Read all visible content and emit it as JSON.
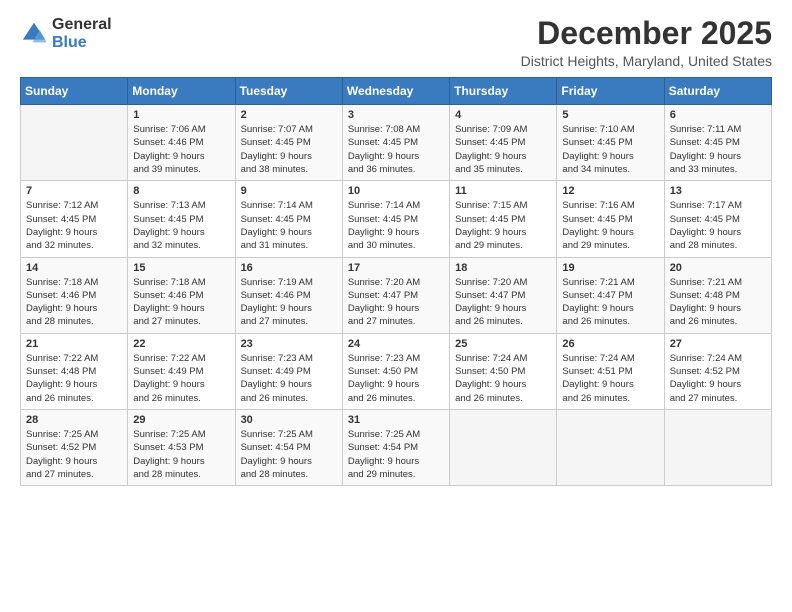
{
  "logo": {
    "general": "General",
    "blue": "Blue"
  },
  "header": {
    "month": "December 2025",
    "location": "District Heights, Maryland, United States"
  },
  "days_of_week": [
    "Sunday",
    "Monday",
    "Tuesday",
    "Wednesday",
    "Thursday",
    "Friday",
    "Saturday"
  ],
  "weeks": [
    [
      {
        "day": "",
        "info": ""
      },
      {
        "day": "1",
        "info": "Sunrise: 7:06 AM\nSunset: 4:46 PM\nDaylight: 9 hours\nand 39 minutes."
      },
      {
        "day": "2",
        "info": "Sunrise: 7:07 AM\nSunset: 4:45 PM\nDaylight: 9 hours\nand 38 minutes."
      },
      {
        "day": "3",
        "info": "Sunrise: 7:08 AM\nSunset: 4:45 PM\nDaylight: 9 hours\nand 36 minutes."
      },
      {
        "day": "4",
        "info": "Sunrise: 7:09 AM\nSunset: 4:45 PM\nDaylight: 9 hours\nand 35 minutes."
      },
      {
        "day": "5",
        "info": "Sunrise: 7:10 AM\nSunset: 4:45 PM\nDaylight: 9 hours\nand 34 minutes."
      },
      {
        "day": "6",
        "info": "Sunrise: 7:11 AM\nSunset: 4:45 PM\nDaylight: 9 hours\nand 33 minutes."
      }
    ],
    [
      {
        "day": "7",
        "info": "Sunrise: 7:12 AM\nSunset: 4:45 PM\nDaylight: 9 hours\nand 32 minutes."
      },
      {
        "day": "8",
        "info": "Sunrise: 7:13 AM\nSunset: 4:45 PM\nDaylight: 9 hours\nand 32 minutes."
      },
      {
        "day": "9",
        "info": "Sunrise: 7:14 AM\nSunset: 4:45 PM\nDaylight: 9 hours\nand 31 minutes."
      },
      {
        "day": "10",
        "info": "Sunrise: 7:14 AM\nSunset: 4:45 PM\nDaylight: 9 hours\nand 30 minutes."
      },
      {
        "day": "11",
        "info": "Sunrise: 7:15 AM\nSunset: 4:45 PM\nDaylight: 9 hours\nand 29 minutes."
      },
      {
        "day": "12",
        "info": "Sunrise: 7:16 AM\nSunset: 4:45 PM\nDaylight: 9 hours\nand 29 minutes."
      },
      {
        "day": "13",
        "info": "Sunrise: 7:17 AM\nSunset: 4:45 PM\nDaylight: 9 hours\nand 28 minutes."
      }
    ],
    [
      {
        "day": "14",
        "info": "Sunrise: 7:18 AM\nSunset: 4:46 PM\nDaylight: 9 hours\nand 28 minutes."
      },
      {
        "day": "15",
        "info": "Sunrise: 7:18 AM\nSunset: 4:46 PM\nDaylight: 9 hours\nand 27 minutes."
      },
      {
        "day": "16",
        "info": "Sunrise: 7:19 AM\nSunset: 4:46 PM\nDaylight: 9 hours\nand 27 minutes."
      },
      {
        "day": "17",
        "info": "Sunrise: 7:20 AM\nSunset: 4:47 PM\nDaylight: 9 hours\nand 27 minutes."
      },
      {
        "day": "18",
        "info": "Sunrise: 7:20 AM\nSunset: 4:47 PM\nDaylight: 9 hours\nand 26 minutes."
      },
      {
        "day": "19",
        "info": "Sunrise: 7:21 AM\nSunset: 4:47 PM\nDaylight: 9 hours\nand 26 minutes."
      },
      {
        "day": "20",
        "info": "Sunrise: 7:21 AM\nSunset: 4:48 PM\nDaylight: 9 hours\nand 26 minutes."
      }
    ],
    [
      {
        "day": "21",
        "info": "Sunrise: 7:22 AM\nSunset: 4:48 PM\nDaylight: 9 hours\nand 26 minutes."
      },
      {
        "day": "22",
        "info": "Sunrise: 7:22 AM\nSunset: 4:49 PM\nDaylight: 9 hours\nand 26 minutes."
      },
      {
        "day": "23",
        "info": "Sunrise: 7:23 AM\nSunset: 4:49 PM\nDaylight: 9 hours\nand 26 minutes."
      },
      {
        "day": "24",
        "info": "Sunrise: 7:23 AM\nSunset: 4:50 PM\nDaylight: 9 hours\nand 26 minutes."
      },
      {
        "day": "25",
        "info": "Sunrise: 7:24 AM\nSunset: 4:50 PM\nDaylight: 9 hours\nand 26 minutes."
      },
      {
        "day": "26",
        "info": "Sunrise: 7:24 AM\nSunset: 4:51 PM\nDaylight: 9 hours\nand 26 minutes."
      },
      {
        "day": "27",
        "info": "Sunrise: 7:24 AM\nSunset: 4:52 PM\nDaylight: 9 hours\nand 27 minutes."
      }
    ],
    [
      {
        "day": "28",
        "info": "Sunrise: 7:25 AM\nSunset: 4:52 PM\nDaylight: 9 hours\nand 27 minutes."
      },
      {
        "day": "29",
        "info": "Sunrise: 7:25 AM\nSunset: 4:53 PM\nDaylight: 9 hours\nand 28 minutes."
      },
      {
        "day": "30",
        "info": "Sunrise: 7:25 AM\nSunset: 4:54 PM\nDaylight: 9 hours\nand 28 minutes."
      },
      {
        "day": "31",
        "info": "Sunrise: 7:25 AM\nSunset: 4:54 PM\nDaylight: 9 hours\nand 29 minutes."
      },
      {
        "day": "",
        "info": ""
      },
      {
        "day": "",
        "info": ""
      },
      {
        "day": "",
        "info": ""
      }
    ]
  ]
}
